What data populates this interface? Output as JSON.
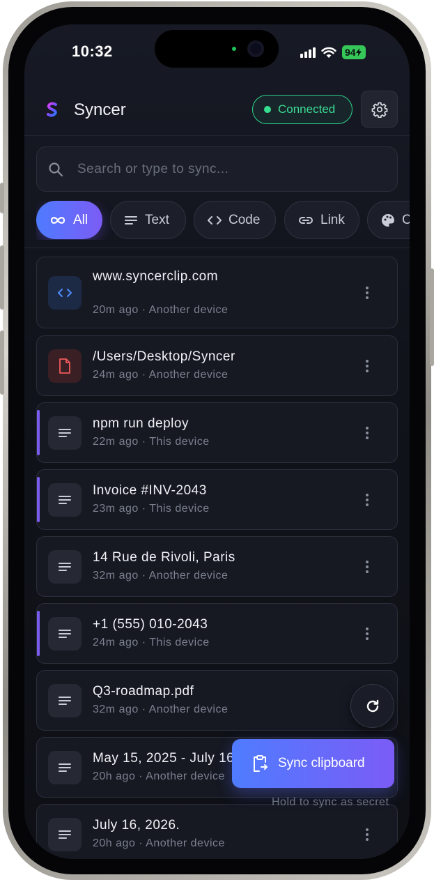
{
  "status_bar": {
    "time": "10:32",
    "battery": "94"
  },
  "header": {
    "app_name": "Syncer",
    "connection_status": "Connected"
  },
  "search": {
    "placeholder": "Search or type to sync..."
  },
  "filters": [
    {
      "label": "All",
      "icon": "infinity-icon",
      "active": true
    },
    {
      "label": "Text",
      "icon": "lines-icon",
      "active": false
    },
    {
      "label": "Code",
      "icon": "code-icon",
      "active": false
    },
    {
      "label": "Link",
      "icon": "link-icon",
      "active": false
    },
    {
      "label": "C",
      "icon": "palette-icon",
      "active": false
    }
  ],
  "items": [
    {
      "title": "www.syncerclip.com",
      "meta": "20m ago · Another device",
      "icon": "code-icon",
      "accent": false
    },
    {
      "title": "/Users/Desktop/Syncer",
      "meta": "24m ago · Another device",
      "icon": "file-icon",
      "accent": false
    },
    {
      "title": "npm run deploy",
      "meta": "22m ago · This device",
      "icon": "text-icon",
      "accent": true
    },
    {
      "title": "Invoice #INV-2043",
      "meta": "23m ago · This device",
      "icon": "text-icon",
      "accent": true
    },
    {
      "title": "14 Rue de Rivoli, Paris",
      "meta": "32m ago · Another device",
      "icon": "text-icon",
      "accent": false
    },
    {
      "title": "+1 (555) 010-2043",
      "meta": "24m ago · This device",
      "icon": "text-icon",
      "accent": true
    },
    {
      "title": "Q3-roadmap.pdf",
      "meta": "32m ago · Another device",
      "icon": "text-icon",
      "accent": false
    },
    {
      "title": "May 15, 2025 - July 16",
      "meta": "20h ago · Another device",
      "icon": "text-icon",
      "accent": false
    },
    {
      "title": "July 16, 2026.",
      "meta": "20h ago · Another device",
      "icon": "text-icon",
      "accent": false
    }
  ],
  "actions": {
    "sync_label": "Sync clipboard",
    "sync_hint": "Hold to sync as secret"
  },
  "colors": {
    "accent_start": "#4f7cff",
    "accent_end": "#7b5cf6",
    "connected": "#3ddc97",
    "background": "#11131b"
  }
}
